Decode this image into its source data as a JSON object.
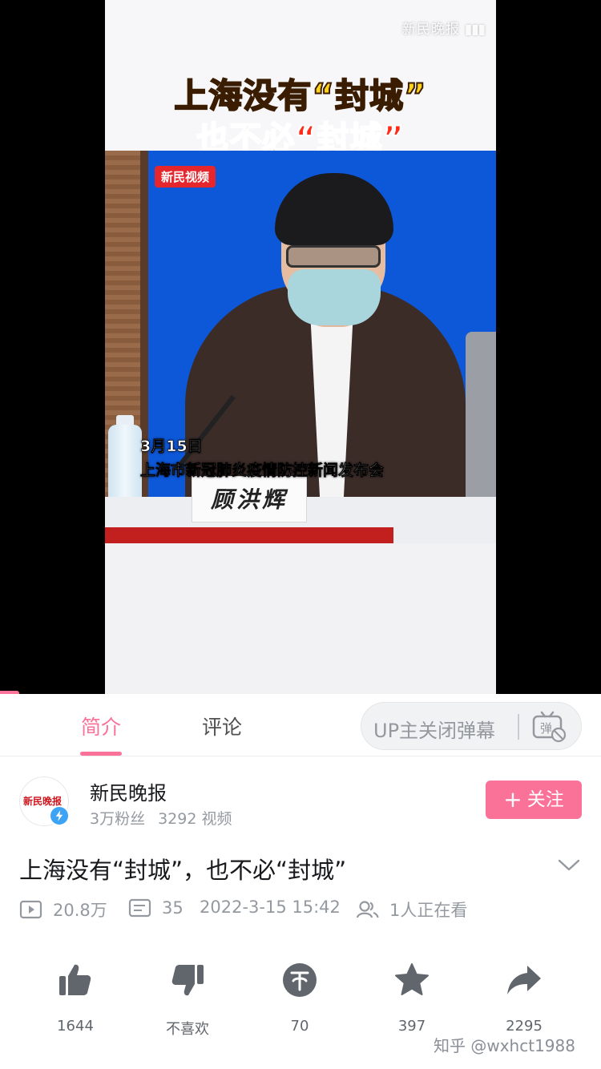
{
  "video": {
    "watermark": "新民晚报",
    "headline_line1": "上海没有“封城”",
    "headline_line2": "也不必“封城”",
    "badge": "新民视频",
    "caption_date": "3月15日",
    "caption_event": "上海市新冠肺炎疫情防控新闻发布会",
    "nameplate": "顾洪辉"
  },
  "tabs": [
    {
      "label": "简介",
      "active": true
    },
    {
      "label": "评论",
      "active": false
    }
  ],
  "danmaku": {
    "label": "UP主关闭弹幕",
    "icon": "danmaku-off-icon"
  },
  "uploader": {
    "name": "新民晚报",
    "avatar_text": "新民晚报",
    "fans": "3万粉丝",
    "videos": "3292 视频",
    "follow_label": "关注"
  },
  "title": "上海没有“封城”，也不必“封城”",
  "meta": {
    "views": "20.8万",
    "danmaku_count": "35",
    "datetime": "2022-3-15 15:42",
    "watching": "1人正在看"
  },
  "actions": [
    {
      "name": "like",
      "icon": "thumbs-up-icon",
      "count": "1644"
    },
    {
      "name": "dislike",
      "icon": "thumbs-down-icon",
      "count": "不喜欢"
    },
    {
      "name": "coin",
      "icon": "coin-icon",
      "count": "70"
    },
    {
      "name": "favorite",
      "icon": "star-icon",
      "count": "397"
    },
    {
      "name": "share",
      "icon": "share-icon",
      "count": "2295"
    }
  ],
  "watermark": "知乎 @wxhct1988",
  "colors": {
    "accent": "#fb7299",
    "verified": "#3da3f5",
    "icon_gray": "#61666d"
  }
}
